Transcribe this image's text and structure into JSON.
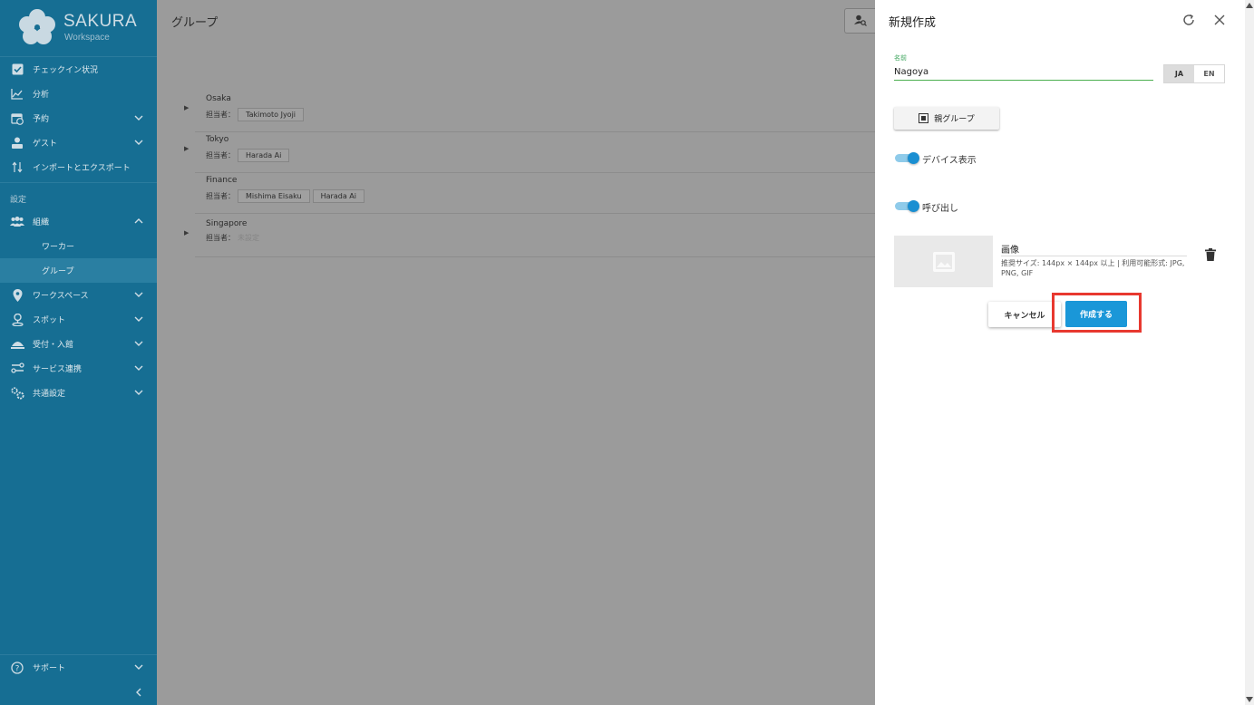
{
  "brand": {
    "name": "SAKURA",
    "sub": "Workspace"
  },
  "sidebar": {
    "items": [
      {
        "label": "チェックイン状況",
        "icon": "checkbox-icon"
      },
      {
        "label": "分析",
        "icon": "chart-line-icon"
      },
      {
        "label": "予約",
        "icon": "calendar-clock-icon",
        "expandable": true
      },
      {
        "label": "ゲスト",
        "icon": "guest-icon",
        "expandable": true
      },
      {
        "label": "インポートとエクスポート",
        "icon": "import-export-icon"
      }
    ],
    "section_label": "設定",
    "settings_items": [
      {
        "label": "組織",
        "icon": "people-icon",
        "expanded": true
      },
      {
        "label": "ワーカー",
        "sub": true
      },
      {
        "label": "グループ",
        "sub": true,
        "active": true
      },
      {
        "label": "ワークスペース",
        "icon": "location-pin-icon",
        "expandable": true
      },
      {
        "label": "スポット",
        "icon": "person-pin-icon",
        "expandable": true
      },
      {
        "label": "受付・入館",
        "icon": "reception-icon",
        "expandable": true
      },
      {
        "label": "サービス連携",
        "icon": "integration-icon",
        "expandable": true
      },
      {
        "label": "共通設定",
        "icon": "cogs-icon",
        "expandable": true
      }
    ],
    "support_label": "サポート"
  },
  "main": {
    "title": "グループ",
    "manager_label": "担当者：",
    "groups": [
      {
        "name": "Osaka",
        "managers": [
          "Takimoto Jyoji"
        ],
        "has_children": true
      },
      {
        "name": "Tokyo",
        "managers": [
          "Harada Ai"
        ],
        "has_children": true
      },
      {
        "name": "Finance",
        "managers": [
          "Mishima Eisaku",
          "Harada Ai"
        ],
        "has_children": false
      },
      {
        "name": "Singapore",
        "managers": [],
        "unset_label": "未設定",
        "has_children": true
      }
    ]
  },
  "panel": {
    "title": "新規作成",
    "name_label": "名前",
    "name_value": "Nagoya",
    "lang": {
      "ja": "JA",
      "en": "EN",
      "selected": "JA"
    },
    "parent_group_label": "親グループ",
    "device_display_label": "デバイス表示",
    "device_display_on": true,
    "call_label": "呼び出し",
    "call_on": true,
    "image_title": "画像",
    "image_desc": "推奨サイズ: 144px × 144px 以上 | 利用可能形式: JPG, PNG, GIF",
    "cancel_label": "キャンセル",
    "create_label": "作成する"
  },
  "colors": {
    "sidebar": "#166e93",
    "accent": "#1a97d8",
    "toggle": "#1a8fd2",
    "highlight": "#e8382f",
    "focus_green": "#4caf50"
  }
}
